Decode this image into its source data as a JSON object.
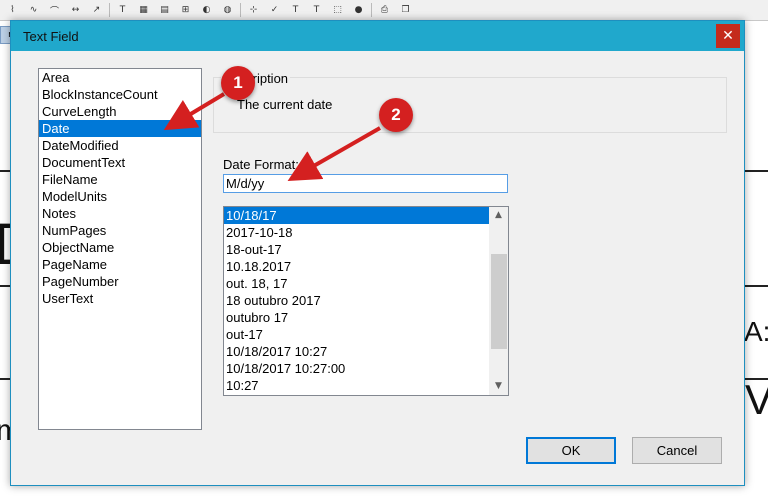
{
  "toolbar": {
    "icons": [
      "polyline-icon",
      "curve-icon",
      "arc-icon",
      "dimension-icon",
      "leader-icon",
      "text-icon",
      "block-icon",
      "hatch-icon",
      "group-icon",
      "material-icon",
      "render-icon",
      "snap-icon",
      "check-icon",
      "text-field-icon",
      "3d-text-icon",
      "box-icon",
      "sphere-icon",
      "print-icon",
      "layers-icon"
    ],
    "left_strip_label": "n"
  },
  "background": {
    "big_letter_left": "D",
    "big_letter_bottom_left": "m",
    "letter_right": "A:",
    "letter_right_lower": "V"
  },
  "dialog": {
    "title": "Text Field",
    "close_label": "✕",
    "fields": [
      "Area",
      "BlockInstanceCount",
      "CurveLength",
      "Date",
      "DateModified",
      "DocumentText",
      "FileName",
      "ModelUnits",
      "Notes",
      "NumPages",
      "ObjectName",
      "PageName",
      "PageNumber",
      "UserText"
    ],
    "selected_field": "Date",
    "description_label": "Description",
    "description_value": "The current date",
    "date_format_label": "Date Format:",
    "date_format_value": "M/d/yy",
    "formats": [
      "10/18/17",
      "2017-10-18",
      "18-out-17",
      "10.18.2017",
      "out. 18, 17",
      "18 outubro 2017",
      "outubro 17",
      "out-17",
      "10/18/2017 10:27",
      "10/18/2017 10:27:00",
      "10:27"
    ],
    "selected_format": "10/18/17",
    "ok_label": "OK",
    "cancel_label": "Cancel"
  },
  "annotations": {
    "callout_1": "1",
    "callout_2": "2",
    "color": "#d42020"
  },
  "colors": {
    "titlebar": "#20a8cc",
    "selection": "#0078d7",
    "close": "#c42b1c"
  }
}
